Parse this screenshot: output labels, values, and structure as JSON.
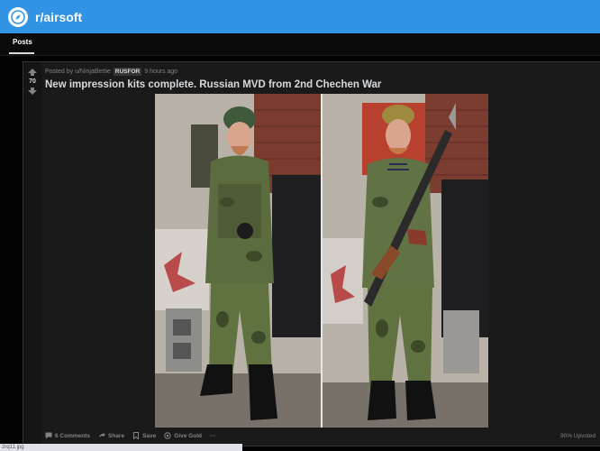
{
  "header": {
    "subreddit": "r/airsoft",
    "accent_color": "#3193e4",
    "logo_icon": "compass-icon"
  },
  "tabs": [
    {
      "label": "Posts",
      "selected": true
    }
  ],
  "post": {
    "score": "70",
    "posted_by": "Posted by u/NinjaBettie",
    "flair": "RUSFOR",
    "time": "9 hours ago",
    "title": "New impression kits complete. Russian MVD from 2nd Chechen War",
    "image_icon": "photo-of-two-soldiers-in-camouflage",
    "actions": {
      "comments": "6 Comments",
      "share": "Share",
      "save": "Save",
      "give_gold": "Give Gold",
      "more": "···"
    },
    "upvoted": "90% Upvoted"
  },
  "status_bar": {
    "filename": "2rq11.jpg"
  }
}
